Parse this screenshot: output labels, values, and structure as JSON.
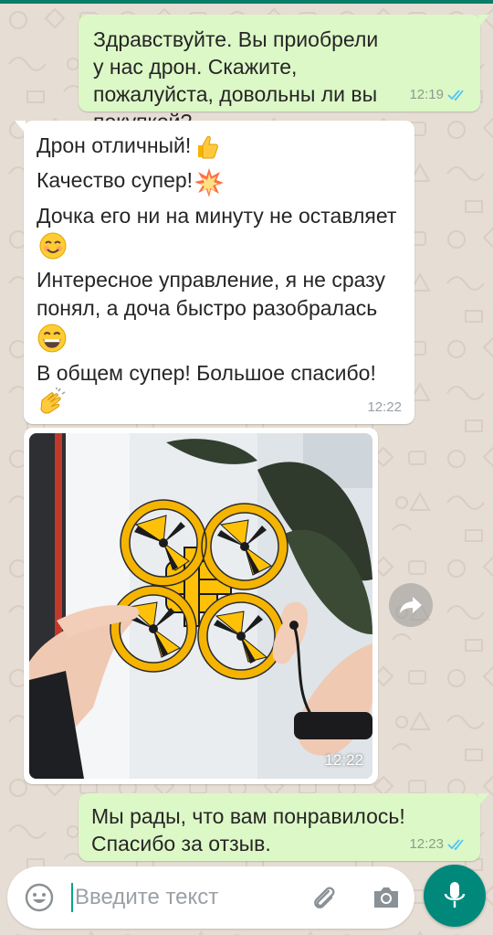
{
  "colors": {
    "outgoing_bubble": "#dcf8c6",
    "incoming_bubble": "#ffffff",
    "read_ticks": "#4fc3f7",
    "accent": "#00897b"
  },
  "messages": [
    {
      "direction": "outgoing",
      "text": "Здравствуйте. Вы приобрели у нас дрон. Скажите, пожалуйста, довольны ли вы покупкой?",
      "time": "12:19",
      "status": "read"
    },
    {
      "direction": "incoming",
      "lines": [
        {
          "text": "Дрон отличный!",
          "emoji": "thumbs-up"
        },
        {
          "text": "Качество супер!",
          "emoji": "collision"
        },
        {
          "text": "Дочка его ни на минуту не оставляет",
          "emoji": "smiling-face"
        },
        {
          "text": "Интересное управление, я не сразу понял, а доча быстро разобралась",
          "emoji": "grinning-face"
        },
        {
          "text": "В общем супер! Большое спасибо!",
          "emoji": "clapping-hands"
        }
      ],
      "time": "12:22"
    },
    {
      "direction": "incoming",
      "type": "photo",
      "photo_subject": "yellow quadcopter drone held in hands",
      "time": "12:22"
    },
    {
      "direction": "outgoing",
      "text": "Мы рады, что вам понравилось! Спасибо за отзыв.",
      "time": "12:23",
      "status": "read"
    }
  ],
  "input": {
    "placeholder": "Введите текст"
  },
  "icons": {
    "emoji_button": "emoji-icon",
    "attach": "paperclip-icon",
    "camera": "camera-icon",
    "mic": "microphone-icon",
    "forward": "forward-icon",
    "ticks": "double-check-icon"
  }
}
